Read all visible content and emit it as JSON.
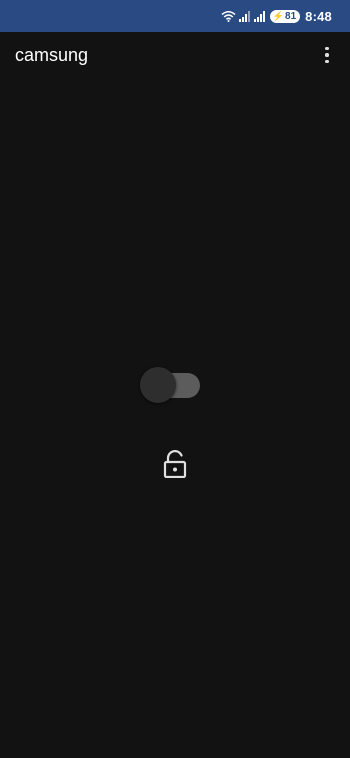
{
  "status_bar": {
    "time": "8:48",
    "battery_level": "81",
    "icons": [
      "wifi-icon",
      "signal-icon",
      "signal-icon",
      "battery-charging-icon"
    ],
    "background_color": "#2a4a83"
  },
  "app_bar": {
    "title": "camsung",
    "menu_icon": "more-vert-icon"
  },
  "main": {
    "toggle": {
      "state": "off",
      "icon": "toggle-switch"
    },
    "lock": {
      "icon": "lock-open-icon",
      "state": "unlocked"
    }
  },
  "colors": {
    "background": "#121212",
    "toggle_track": "#5c5c5c",
    "toggle_thumb": "#2e2e2e",
    "icon": "#e0e0e0"
  }
}
